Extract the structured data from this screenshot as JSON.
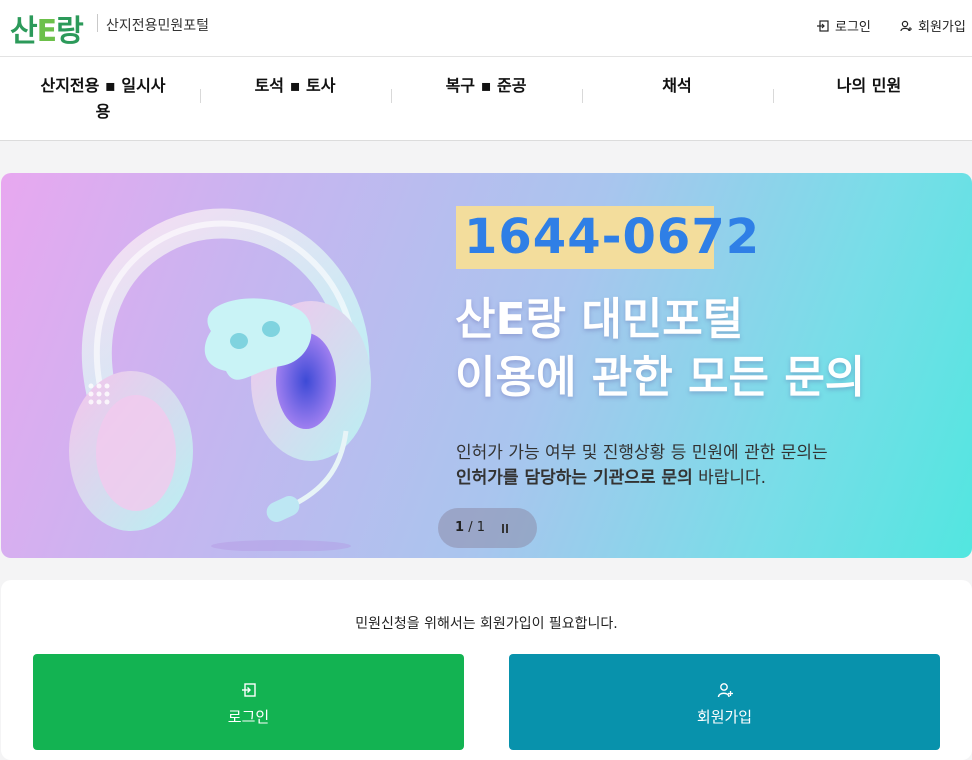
{
  "header": {
    "logo_main": "산",
    "logo_e": "E",
    "logo_tail": "랑",
    "logo_subtitle": "산지전용민원포털",
    "login_label": "로그인",
    "join_label": "회원가입"
  },
  "nav": {
    "items": [
      {
        "label_line1": "산지전용 ▪ 일시사",
        "label_line2": "용"
      },
      {
        "label_line1": "토석 ▪ 토사",
        "label_line2": ""
      },
      {
        "label_line1": "복구 ▪ 준공",
        "label_line2": ""
      },
      {
        "label_line1": "채석",
        "label_line2": ""
      },
      {
        "label_line1": "나의 민원",
        "label_line2": ""
      }
    ]
  },
  "banner": {
    "phone": "1644-0672",
    "headline_line1": "산E랑 대민포털",
    "headline_line2": "이용에 관한 모든 문의",
    "desc_line1": "인허가 가능 여부 및 진행상황 등 민원에 관한 문의는",
    "desc_line2_bold": "인허가를 담당하는 기관으로 문의",
    "desc_line2_tail": " 바랍니다.",
    "pager_current": "1",
    "pager_total": "/ 1"
  },
  "panel": {
    "notice": "민원신청을 위해서는 회원가입이 필요합니다.",
    "login_button": "로그인",
    "join_button": "회원가입"
  },
  "colors": {
    "login_green": "#13b352",
    "join_teal": "#0892ac",
    "phone_blue": "#2f7fe6",
    "logo_green": "#2c9a5a"
  }
}
